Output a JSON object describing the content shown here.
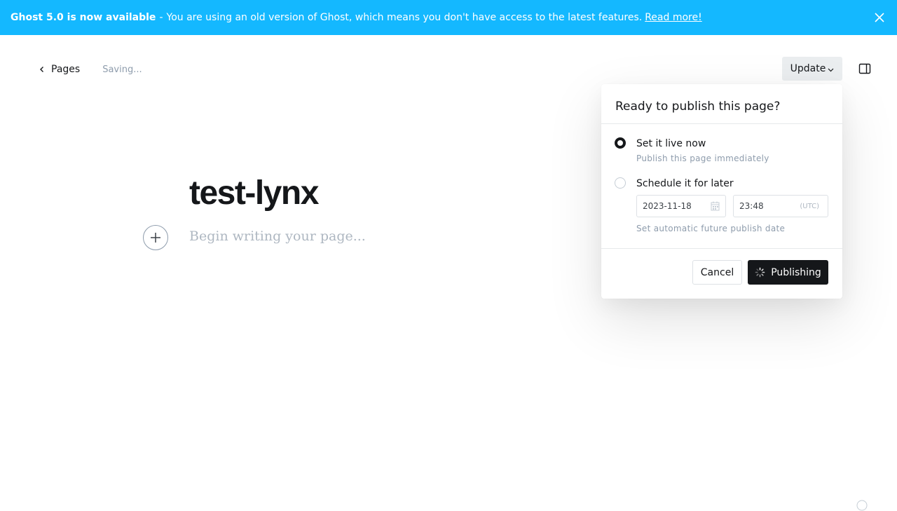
{
  "banner": {
    "title": "Ghost 5.0 is now available",
    "separator": "-",
    "message": "You are using an old version of Ghost, which means you don't have access to the latest features.",
    "link_label": "Read more!",
    "close_icon": "close-icon"
  },
  "topbar": {
    "back_label": "Pages",
    "back_icon": "chevron-left-icon",
    "status": "Saving...",
    "update_label": "Update",
    "update_icon": "chevron-down-icon",
    "sidebar_icon": "sidebar-toggle-icon"
  },
  "editor": {
    "title": "test-lynx",
    "body_placeholder": "Begin writing your page...",
    "add_card_icon": "plus-icon"
  },
  "publish_menu": {
    "title": "Ready to publish this page?",
    "options": [
      {
        "label": "Set it live now",
        "description": "Publish this page immediately",
        "selected": true
      },
      {
        "label": "Schedule it for later",
        "description": "Set automatic future publish date",
        "selected": false
      }
    ],
    "date_value": "2023-11-18",
    "date_icon": "calendar-icon",
    "time_value": "23:48",
    "timezone": "(UTC)",
    "cancel_label": "Cancel",
    "publish_label": "Publishing",
    "publish_icon": "spinner-icon"
  },
  "colors": {
    "banner_bg": "#14b8ff",
    "primary_dark": "#15171a",
    "muted_text": "#8e9cac"
  }
}
